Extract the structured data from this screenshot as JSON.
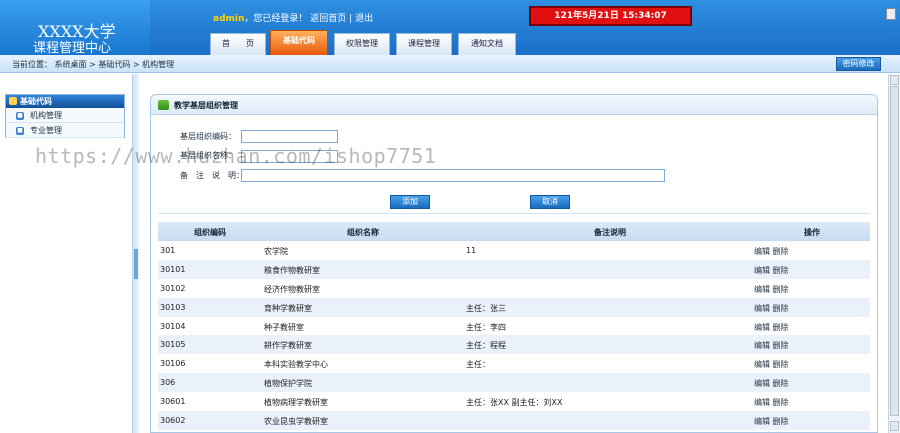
{
  "header": {
    "logo_line1": "XXXX大学",
    "logo_line2": "课程管理中心",
    "user": "admin",
    "login_text": "，您已经登录！",
    "home_link": "返回首页",
    "divider": "|",
    "logout_link": "退出",
    "clock": "121年5月21日   15:34:07"
  },
  "tabs": [
    {
      "label": "首　　页"
    },
    {
      "label": "基础代码"
    },
    {
      "label": "权限管理"
    },
    {
      "label": "课程管理"
    },
    {
      "label": "通知文档"
    }
  ],
  "breadcrumb": "当前位置：  系统桌面 > 基础代码 > 机构管理",
  "change_password": "密码修改",
  "sidebar": {
    "title": "基础代码",
    "items": [
      {
        "label": "机构管理"
      },
      {
        "label": "专业管理"
      }
    ]
  },
  "panel": {
    "title": "教学基层组织管理"
  },
  "form": {
    "code_label": "基层组织编码：",
    "name_label": "基层组织名称：",
    "remark_label": "备　注　说　明：",
    "add_button": "添加",
    "cancel_button": "取消"
  },
  "table": {
    "headers": [
      "组织编码",
      "组织名称",
      "备注说明",
      "操作"
    ],
    "edit_label": "编辑",
    "delete_label": "删除",
    "rows": [
      {
        "code": "301",
        "name": "农学院",
        "remark": "11"
      },
      {
        "code": "30101",
        "name": "粮食作物教研室",
        "remark": ""
      },
      {
        "code": "30102",
        "name": "经济作物教研室",
        "remark": ""
      },
      {
        "code": "30103",
        "name": "育种学教研室",
        "remark": "主任：张三"
      },
      {
        "code": "30104",
        "name": "种子教研室",
        "remark": "主任：李四"
      },
      {
        "code": "30105",
        "name": "耕作学教研室",
        "remark": "主任：程程"
      },
      {
        "code": "30106",
        "name": "本科实验教学中心",
        "remark": "主任："
      },
      {
        "code": "306",
        "name": "植物保护学院",
        "remark": ""
      },
      {
        "code": "30601",
        "name": "植物病理学教研室",
        "remark": "主任：张XX 副主任：刘XX"
      },
      {
        "code": "30602",
        "name": "农业昆虫学教研室",
        "remark": ""
      }
    ]
  },
  "watermark": "https://www.huzhan.com/ishop7751"
}
